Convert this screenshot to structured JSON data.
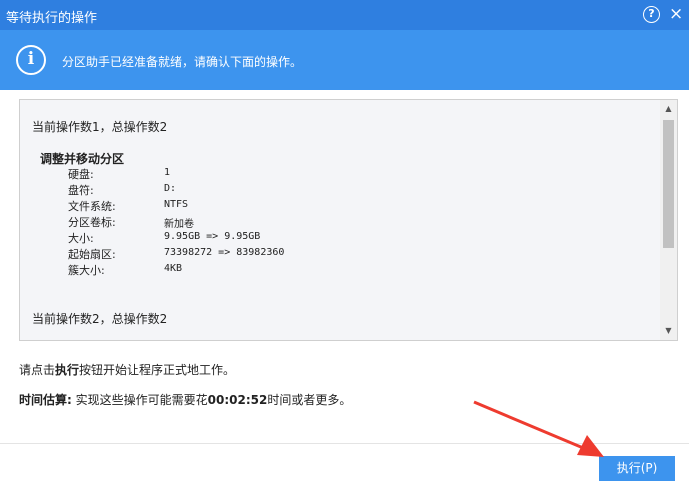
{
  "window": {
    "title": "等待执行的操作",
    "help_label": "?",
    "close_label": "×"
  },
  "banner": {
    "icon": "info-icon",
    "message": "分区助手已经准备就绪，请确认下面的操作。"
  },
  "operations": {
    "op1_header": "当前操作数1，总操作数2",
    "op1_title": "调整并移动分区",
    "op1_details": [
      {
        "key": "硬盘:",
        "value": "1"
      },
      {
        "key": "盘符:",
        "value": "D:"
      },
      {
        "key": "文件系统:",
        "value": "NTFS"
      },
      {
        "key": "分区卷标:",
        "value": "新加卷"
      },
      {
        "key": "大小:",
        "value": "9.95GB => 9.95GB"
      },
      {
        "key": "起始扇区:",
        "value": "73398272 => 83982360"
      },
      {
        "key": "簇大小:",
        "value": "4KB"
      }
    ],
    "op2_header": "当前操作数2，总操作数2"
  },
  "scrollbar": {
    "up_arrow": "▲",
    "down_arrow": "▼"
  },
  "instruction": {
    "prefix": "请点击",
    "keyword": "执行",
    "suffix": "按钮开始让程序正式地工作。"
  },
  "estimate": {
    "label": "时间估算:",
    "prefix": " 实现这些操作可能需要花",
    "time": "00:02:52",
    "suffix": "时间或者更多。"
  },
  "footer": {
    "execute_label": "执行(P)"
  },
  "colors": {
    "titlebar": "#2f7fe0",
    "banner": "#3d94ee",
    "arrow": "#ee3b2f"
  }
}
